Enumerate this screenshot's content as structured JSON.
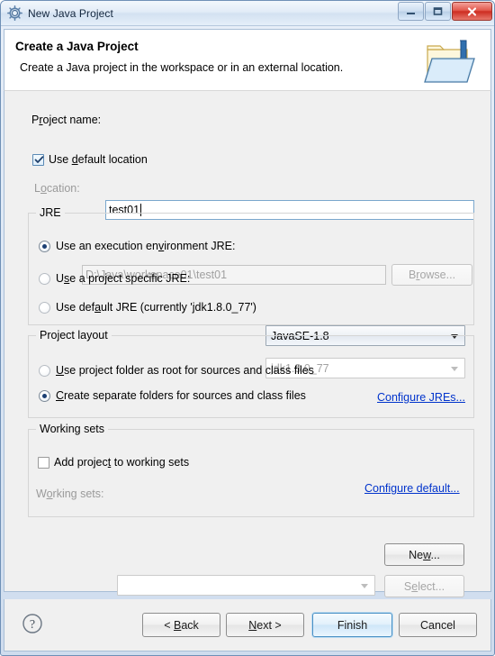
{
  "window": {
    "title": "New Java Project",
    "icon": "gear-icon",
    "caption": {
      "minimize_label": "Minimize",
      "maximize_label": "Maximize",
      "close_label": "Close"
    }
  },
  "header": {
    "title": "Create a Java Project",
    "description": "Create a Java project in the workspace or in an external location.",
    "banner_icon": "java-project-folder-icon"
  },
  "form": {
    "project_name": {
      "label_before": "P",
      "label_mnemonic": "r",
      "label_after": "oject name:",
      "value": "test01",
      "placeholder": ""
    },
    "use_default_location": {
      "label_before": "Use ",
      "label_mnemonic": "d",
      "label_after": "efault location",
      "checked": true
    },
    "location": {
      "label_before": "L",
      "label_mnemonic": "o",
      "label_after": "cation:",
      "value": "D:\\Java\\workspace01\\test01",
      "enabled": false
    },
    "browse_button": {
      "label_before": "B",
      "label_mnemonic": "r",
      "label_after": "owse...",
      "enabled": false
    }
  },
  "jre_group": {
    "title": "JRE",
    "option_execution_env": {
      "label_before": "Use an execution en",
      "label_mnemonic": "v",
      "label_after": "ironment JRE:",
      "selected": true
    },
    "execution_env_value": "JavaSE-1.8",
    "option_project_specific": {
      "label_before": "U",
      "label_mnemonic": "s",
      "label_after": "e a project specific JRE:",
      "selected": false
    },
    "project_specific_value": "jdk1.8.0_77",
    "option_default_jre": {
      "label_before": "Use def",
      "label_mnemonic": "a",
      "label_after": "ult JRE (currently 'jdk1.8.0_77')",
      "selected": false
    },
    "configure_jres_link": "Configure JREs..."
  },
  "project_layout_group": {
    "title": "Project layout",
    "option_project_folder_root": {
      "label_before": "",
      "label_mnemonic": "U",
      "label_after": "se project folder as root for sources and class files",
      "selected": false
    },
    "option_separate_folders": {
      "label_before": "",
      "label_mnemonic": "C",
      "label_after": "reate separate folders for sources and class files",
      "selected": true
    },
    "configure_default_link": "Configure default..."
  },
  "working_sets_group": {
    "title": "Working sets",
    "add_project_checkbox": {
      "label_before": "Add projec",
      "label_mnemonic": "t",
      "label_after": " to working sets",
      "checked": false
    },
    "working_sets_label": {
      "label_before": "W",
      "label_mnemonic": "o",
      "label_after": "rking sets:"
    },
    "working_sets_value": "",
    "new_button": {
      "label_before": "Ne",
      "label_mnemonic": "w",
      "label_after": "...",
      "enabled": true
    },
    "select_button": {
      "label_before": "S",
      "label_mnemonic": "e",
      "label_after": "lect...",
      "enabled": false
    }
  },
  "footer": {
    "help_icon": "help-question-icon",
    "back_button": {
      "label_before": "< ",
      "label_mnemonic": "B",
      "label_after": "ack"
    },
    "next_button": {
      "label_before": "",
      "label_mnemonic": "N",
      "label_after": "ext >"
    },
    "finish_button": {
      "label": "Finish",
      "is_default": true
    },
    "cancel_button": {
      "label": "Cancel"
    }
  },
  "colors": {
    "link": "#0033cc",
    "body_background": "#f0f0f0",
    "header_background": "#ffffff",
    "radio_dot": "#1b3f73",
    "default_button_border": "#4a90c4",
    "close_button": "#cd2d21"
  }
}
